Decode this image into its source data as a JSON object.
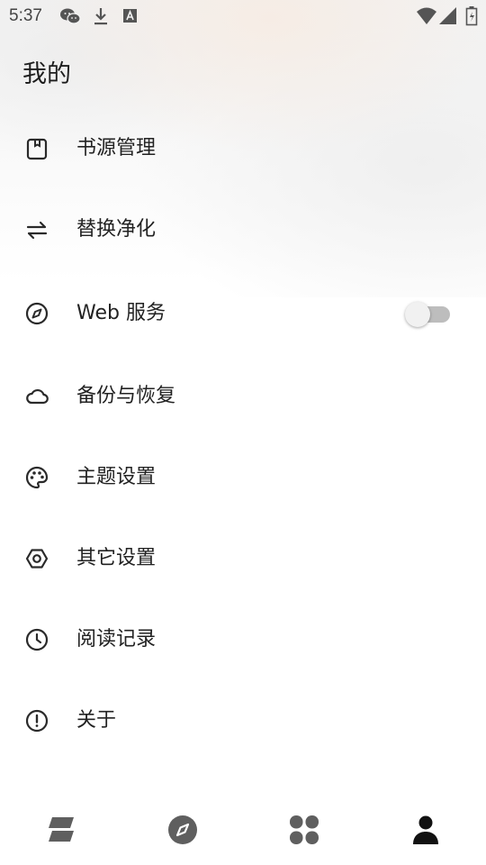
{
  "status_bar": {
    "time": "5:37",
    "left_icons": [
      "wechat-icon",
      "download-icon",
      "a-letter-notification-icon"
    ],
    "right_icons": [
      "wifi-icon",
      "cellular-signal-icon",
      "battery-icon"
    ]
  },
  "page": {
    "title": "我的"
  },
  "menu": {
    "items": [
      {
        "label": "书源管理",
        "icon": "book-source-icon"
      },
      {
        "label": "替换净化",
        "icon": "swap-arrows-icon"
      },
      {
        "label": "Web 服务",
        "icon": "compass-icon",
        "toggle": false
      },
      {
        "label": "备份与恢复",
        "icon": "cloud-icon"
      },
      {
        "label": "主题设置",
        "icon": "palette-icon"
      },
      {
        "label": "其它设置",
        "icon": "hexagon-settings-icon"
      },
      {
        "label": "阅读记录",
        "icon": "clock-icon"
      },
      {
        "label": "关于",
        "icon": "info-alert-icon"
      }
    ]
  },
  "bottom_nav": {
    "items": [
      {
        "icon": "bookshelf-icon",
        "selected": false
      },
      {
        "icon": "explore-compass-icon",
        "selected": false
      },
      {
        "icon": "rss-grid-icon",
        "selected": false
      },
      {
        "icon": "person-icon",
        "selected": true
      }
    ]
  },
  "colors": {
    "text": "#222222",
    "icon": "#2a2a2a",
    "nav_inactive": "#5f5f5f",
    "nav_active": "#111111",
    "toggle_track": "#bdbdbd",
    "toggle_thumb": "#f1f1f1"
  }
}
